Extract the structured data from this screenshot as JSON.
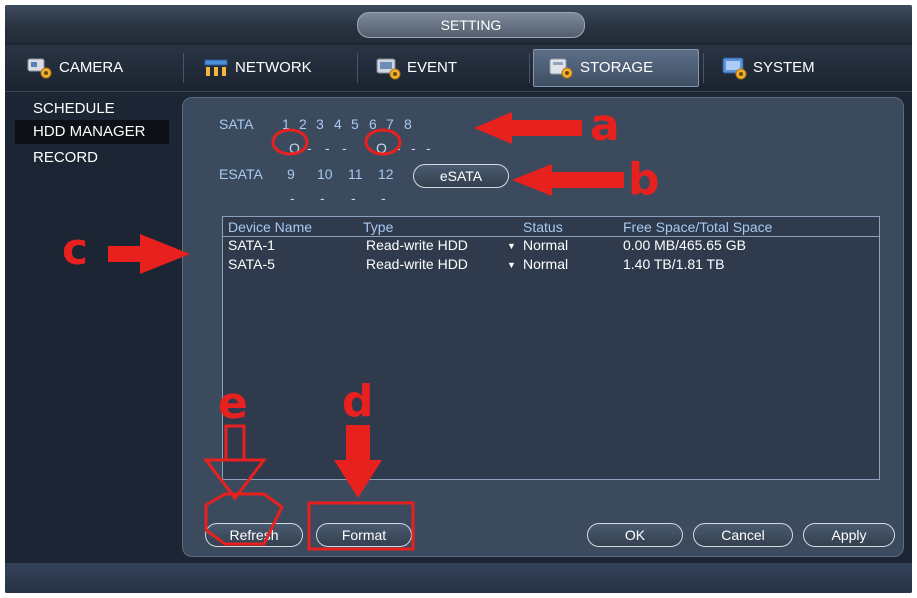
{
  "window": {
    "title": "SETTING"
  },
  "tabs": [
    {
      "label": "CAMERA",
      "icon": "camera-gear-icon"
    },
    {
      "label": "NETWORK",
      "icon": "network-icon"
    },
    {
      "label": "EVENT",
      "icon": "event-icon"
    },
    {
      "label": "STORAGE",
      "icon": "storage-gear-icon",
      "active": true
    },
    {
      "label": "SYSTEM",
      "icon": "system-monitor-icon"
    }
  ],
  "sidebar": {
    "items": [
      {
        "label": "SCHEDULE"
      },
      {
        "label": "HDD MANAGER",
        "active": true
      },
      {
        "label": "RECORD"
      }
    ]
  },
  "sata": {
    "label": "SATA",
    "ports": [
      "1",
      "2",
      "3",
      "4",
      "5",
      "6",
      "7",
      "8"
    ],
    "states": [
      "O",
      "-",
      "-",
      "-",
      "O",
      "-",
      "-",
      "-"
    ]
  },
  "esata": {
    "label": "ESATA",
    "ports": [
      "9",
      "10",
      "11",
      "12"
    ],
    "states": [
      "-",
      "-",
      "-",
      "-"
    ],
    "button_label": "eSATA"
  },
  "table": {
    "columns": [
      "Device Name",
      "Type",
      "Status",
      "Free Space/Total Space"
    ],
    "rows": [
      {
        "device": "SATA-1",
        "type": "Read-write HDD",
        "status": "Normal",
        "space": "0.00 MB/465.65 GB"
      },
      {
        "device": "SATA-5",
        "type": "Read-write HDD",
        "status": "Normal",
        "space": "1.40 TB/1.81 TB"
      }
    ]
  },
  "buttons": {
    "refresh": "Refresh",
    "format": "Format",
    "ok": "OK",
    "cancel": "Cancel",
    "apply": "Apply"
  },
  "annotations": {
    "a": "a",
    "b": "b",
    "c": "c",
    "d": "d",
    "e": "e"
  },
  "colors": {
    "annotation": "#e8201e",
    "label_blue": "#a9c9f0",
    "panel": "#3c4a5d"
  }
}
